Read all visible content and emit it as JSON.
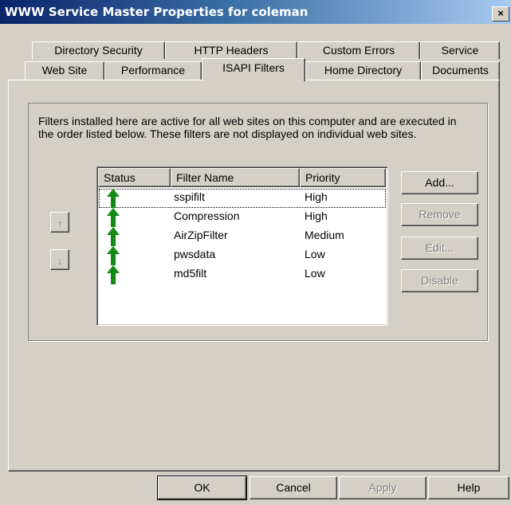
{
  "window": {
    "title": "WWW Service Master Properties for coleman",
    "close_glyph": "×"
  },
  "tabs_back": [
    {
      "label": "Directory Security"
    },
    {
      "label": "HTTP Headers"
    },
    {
      "label": "Custom Errors"
    },
    {
      "label": "Service"
    }
  ],
  "tabs_front": [
    {
      "label": "Web Site"
    },
    {
      "label": "Performance"
    },
    {
      "label": "ISAPI Filters"
    },
    {
      "label": "Home Directory"
    },
    {
      "label": "Documents"
    }
  ],
  "active_tab": "ISAPI Filters",
  "description": "Filters installed here are active for all web sites on this computer and are executed in the order listed below.  These filters are not displayed on individual web sites.",
  "filters_table": {
    "columns": [
      "Status",
      "Filter Name",
      "Priority"
    ],
    "rows": [
      {
        "status": "loaded-up-arrow",
        "name": "sspifilt",
        "priority": "High"
      },
      {
        "status": "loaded-up-arrow",
        "name": "Compression",
        "priority": "High"
      },
      {
        "status": "loaded-up-arrow",
        "name": "AirZipFilter",
        "priority": "Medium"
      },
      {
        "status": "loaded-up-arrow",
        "name": "pwsdata",
        "priority": "Low"
      },
      {
        "status": "loaded-up-arrow",
        "name": "md5filt",
        "priority": "Low"
      }
    ],
    "selected_row": 0
  },
  "move": {
    "up_glyph": "↑",
    "down_glyph": "↓"
  },
  "side_buttons": {
    "add": {
      "label": "Add...",
      "enabled": true
    },
    "remove": {
      "label": "Remove",
      "enabled": false
    },
    "edit": {
      "label": "Edit...",
      "enabled": false
    },
    "disable": {
      "label": "Disable",
      "enabled": false
    }
  },
  "footer_buttons": {
    "ok": "OK",
    "cancel": "Cancel",
    "apply": "Apply",
    "help": "Help"
  },
  "colors": {
    "face": "#d4d0c8",
    "title_start": "#0a246a",
    "status_arrow": "#138a13"
  }
}
